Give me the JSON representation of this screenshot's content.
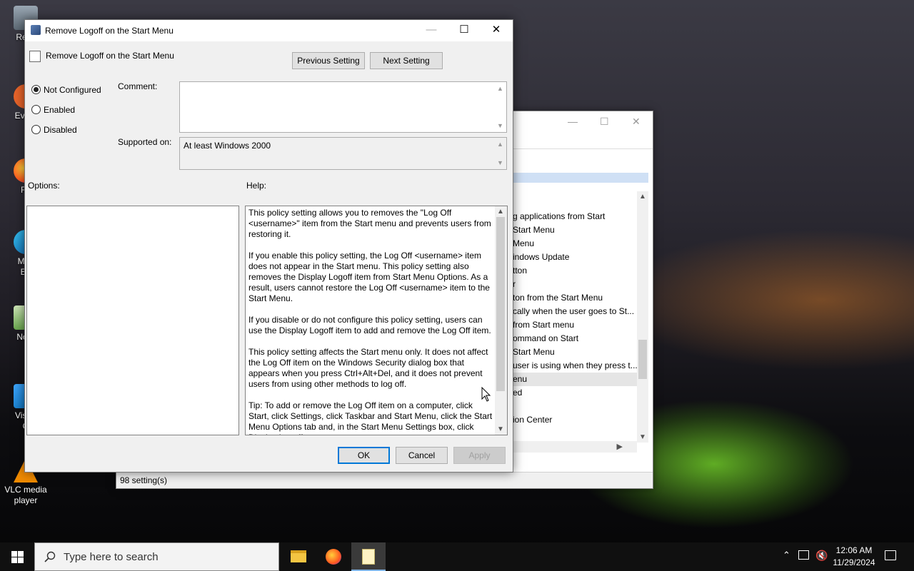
{
  "desktop": {
    "icons": [
      {
        "label": "Recy"
      },
      {
        "label": "Every"
      },
      {
        "label": "Fir"
      },
      {
        "label": "Micr Ed"
      },
      {
        "label": "Note"
      },
      {
        "label": "Visual C"
      },
      {
        "label": "VLC media player"
      }
    ]
  },
  "background_window": {
    "list_items": [
      "g applications from Start",
      "Start Menu",
      "Menu",
      "indows Update",
      "tton",
      "r",
      "ton from the Start Menu",
      "cally when the user goes to St...",
      "from Start menu",
      "ommand on Start",
      "Start Menu",
      "user is using when they press t...",
      "enu",
      "ed",
      "",
      "ion Center"
    ],
    "status": "98 setting(s)"
  },
  "dialog": {
    "title": "Remove Logoff on the Start Menu",
    "policy_name": "Remove Logoff on the Start Menu",
    "prev_button": "Previous Setting",
    "next_button": "Next Setting",
    "radios": {
      "not_configured": "Not Configured",
      "enabled": "Enabled",
      "disabled": "Disabled",
      "selected": "not_configured"
    },
    "comment_label": "Comment:",
    "comment_value": "",
    "supported_label": "Supported on:",
    "supported_value": "At least Windows 2000",
    "options_label": "Options:",
    "help_label": "Help:",
    "help_paragraphs": [
      "This policy setting allows you to removes the \"Log Off <username>\" item from the Start menu and prevents users from restoring it.",
      "If you enable this policy setting, the Log Off <username> item does not appear in the Start menu. This policy setting also removes the Display Logoff item from Start Menu Options. As a result, users cannot restore the Log Off <username> item to the Start Menu.",
      "If you disable or do not configure this policy setting, users can use the Display Logoff item to add and remove the Log Off item.",
      "This policy setting affects the Start menu only. It does not affect the Log Off item on the Windows Security dialog box that appears when you press Ctrl+Alt+Del, and it does not prevent users from using other methods to log off.",
      "Tip: To add or remove the Log Off item on a computer, click Start, click Settings, click Taskbar and Start Menu, click the Start Menu Options tab and, in the Start Menu Settings box, click Display Logoff."
    ],
    "ok_button": "OK",
    "cancel_button": "Cancel",
    "apply_button": "Apply"
  },
  "taskbar": {
    "search_placeholder": "Type here to search",
    "time": "12:06 AM",
    "date": "11/29/2024",
    "apps": [
      "file-explorer-icon",
      "firefox-icon",
      "notepad-icon"
    ]
  }
}
